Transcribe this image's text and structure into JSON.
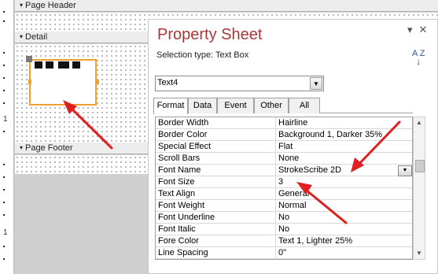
{
  "designer": {
    "page_header_label": "Page Header",
    "detail_label": "Detail",
    "page_footer_label": "Page Footer",
    "ruler_number": "1"
  },
  "property_sheet": {
    "title": "Property Sheet",
    "selection_type_label": "Selection type:  Text Box",
    "control_combo_value": "Text4",
    "tabs": [
      {
        "label": "Format",
        "active": true
      },
      {
        "label": "Data",
        "active": false
      },
      {
        "label": "Event",
        "active": false
      },
      {
        "label": "Other",
        "active": false
      },
      {
        "label": "All",
        "active": false
      }
    ],
    "rows": [
      {
        "name": "Border Width",
        "value": "Hairline"
      },
      {
        "name": "Border Color",
        "value": "Background 1, Darker 35%"
      },
      {
        "name": "Special Effect",
        "value": "Flat"
      },
      {
        "name": "Scroll Bars",
        "value": "None"
      },
      {
        "name": "Font Name",
        "value": "StrokeScribe 2D"
      },
      {
        "name": "Font Size",
        "value": "3"
      },
      {
        "name": "Text Align",
        "value": "General"
      },
      {
        "name": "Font Weight",
        "value": "Normal"
      },
      {
        "name": "Font Underline",
        "value": "No"
      },
      {
        "name": "Font Italic",
        "value": "No"
      },
      {
        "name": "Fore Color",
        "value": "Text 1, Lighter 25%"
      },
      {
        "name": "Line Spacing",
        "value": "0\""
      }
    ],
    "sort_icon_text": "A Z"
  },
  "colors": {
    "title_red": "#a4373a",
    "selection_orange": "#f0a030",
    "arrow_red": "#e02020"
  },
  "icons": {
    "close": "close-icon",
    "dropdown": "chevron-down-icon",
    "sort": "sort-az-icon"
  }
}
